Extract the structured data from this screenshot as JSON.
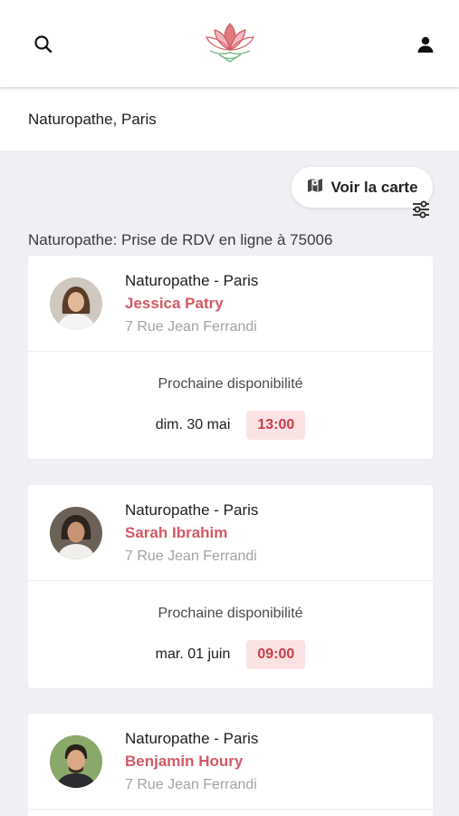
{
  "header": {
    "search_icon": "search-icon",
    "logo_icon": "lotus-logo",
    "user_icon": "user-icon",
    "brand_color": "#d25a64",
    "leaf_color": "#7dbb8a"
  },
  "search": {
    "query": "Naturopathe, Paris",
    "filter_icon": "sliders-icon"
  },
  "map_button": {
    "label": "Voir la carte",
    "icon": "map-icon"
  },
  "results": {
    "title": "Naturopathe: Prise de RDV en ligne à 75006",
    "cards": [
      {
        "specialty": "Naturopathe - Paris",
        "name": "Jessica Patry",
        "address": "7 Rue Jean Ferrandi",
        "availability_label": "Prochaine disponibilité",
        "date": "dim. 30 mai",
        "time": "13:00"
      },
      {
        "specialty": "Naturopathe - Paris",
        "name": "Sarah Ibrahim",
        "address": "7 Rue Jean Ferrandi",
        "availability_label": "Prochaine disponibilité",
        "date": "mar. 01 juin",
        "time": "09:00"
      },
      {
        "specialty": "Naturopathe - Paris",
        "name": "Benjamin Houry",
        "address": "7 Rue Jean Ferrandi"
      }
    ]
  }
}
